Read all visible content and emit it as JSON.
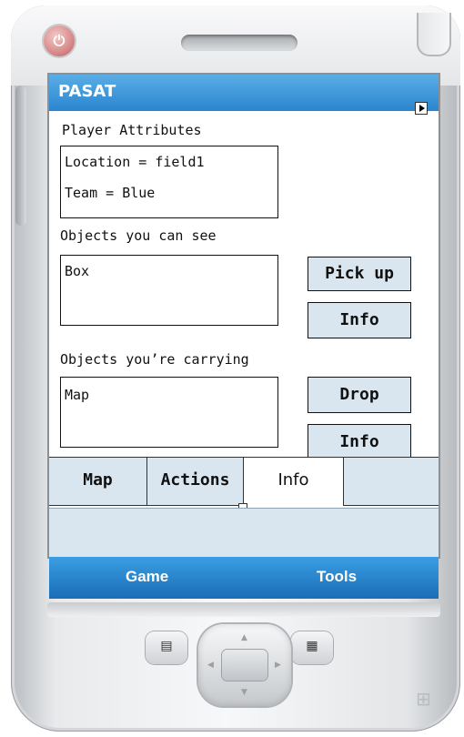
{
  "app": {
    "title": "PASAT"
  },
  "sections": {
    "attributes": {
      "label": "Player Attributes",
      "lines": [
        "Location = field1",
        "Team = Blue"
      ]
    },
    "visible": {
      "label": "Objects you can see",
      "items": [
        "Box"
      ],
      "buttons": [
        "Pick up",
        "Info"
      ]
    },
    "carrying": {
      "label": "Objects you’re carrying",
      "items": [
        "Map"
      ],
      "buttons": [
        "Drop",
        "Info"
      ]
    }
  },
  "tabs": [
    {
      "label": "Map",
      "active": false
    },
    {
      "label": "Actions",
      "active": false
    },
    {
      "label": "Info",
      "active": true
    },
    {
      "label": "",
      "active": false
    }
  ],
  "menu": {
    "left": "Game",
    "right": "Tools"
  },
  "colors": {
    "titlebar": "#2b86cf",
    "button_bg": "#d9e6ef",
    "menubar": "#1a6db6"
  },
  "icons": [
    "power-icon",
    "contacts-icon",
    "calendar-icon",
    "scroll-right-icon",
    "windows-logo-icon"
  ]
}
